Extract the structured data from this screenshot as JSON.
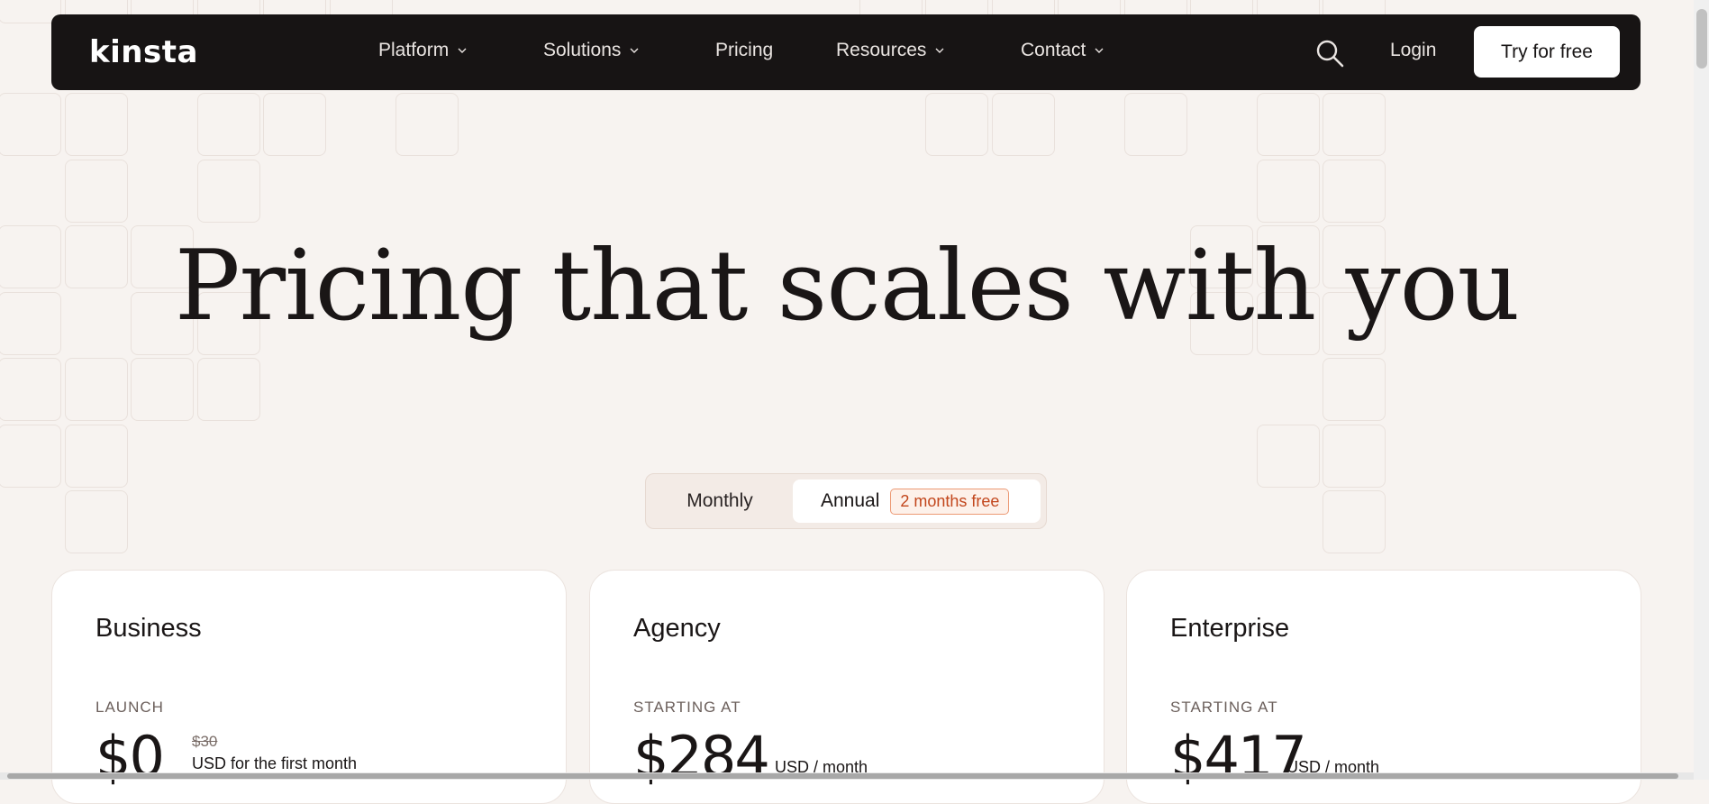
{
  "brand": {
    "logo_text": "kinsta"
  },
  "nav": {
    "items": [
      {
        "label": "Platform",
        "has_dropdown": true
      },
      {
        "label": "Solutions",
        "has_dropdown": true
      },
      {
        "label": "Pricing",
        "has_dropdown": false
      },
      {
        "label": "Resources",
        "has_dropdown": true
      },
      {
        "label": "Contact",
        "has_dropdown": true
      }
    ],
    "search_icon": "search-icon",
    "login_label": "Login",
    "cta_label": "Try for free"
  },
  "hero": {
    "title": "Pricing that scales with you"
  },
  "billing_toggle": {
    "monthly_label": "Monthly",
    "annual_label": "Annual",
    "annual_badge": "2 months free",
    "selected": "Annual"
  },
  "plans": [
    {
      "name": "Business",
      "kicker": "LAUNCH",
      "price": "$0",
      "original_price": "$30",
      "unit": "USD for the first month"
    },
    {
      "name": "Agency",
      "kicker": "STARTING AT",
      "price": "$284",
      "unit": "USD / month"
    },
    {
      "name": "Enterprise",
      "kicker": "STARTING AT",
      "price": "$417",
      "unit": "USD / month"
    }
  ],
  "colors": {
    "page_bg": "#f7f3f0",
    "nav_bg": "#171414",
    "badge_accent": "#c2461c"
  }
}
